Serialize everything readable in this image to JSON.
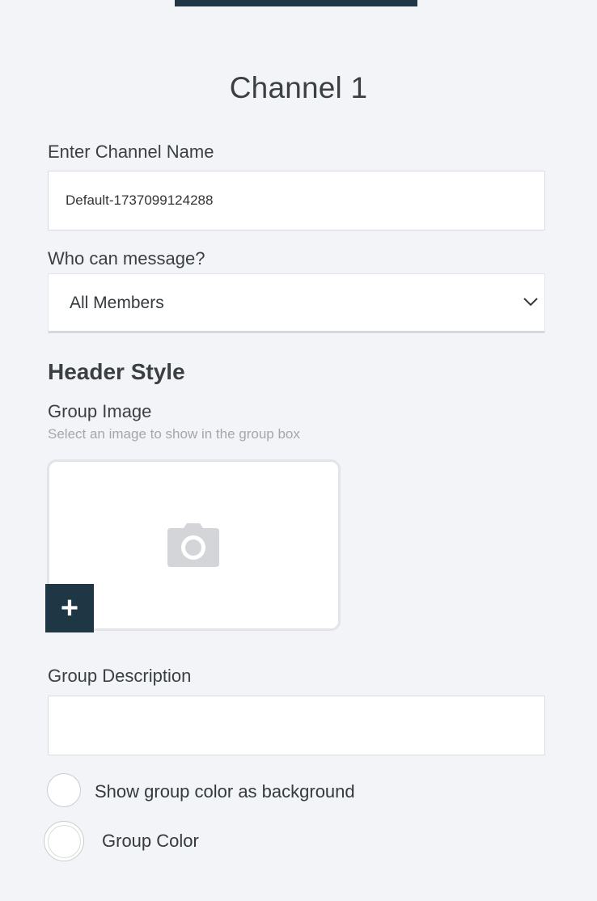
{
  "header": {
    "title": "Channel 1"
  },
  "channel_name": {
    "label": "Enter Channel Name",
    "value": "Default-1737099124288"
  },
  "message_permission": {
    "label": "Who can message?",
    "selected": "All Members"
  },
  "header_style": {
    "heading": "Header Style",
    "group_image": {
      "label": "Group Image",
      "hint": "Select an image to show in the group box",
      "placeholder_icon": "camera-icon",
      "add_icon": "plus-icon",
      "add_symbol": "+"
    },
    "group_description": {
      "label": "Group Description",
      "value": ""
    },
    "show_color_background": {
      "label": "Show group color as background",
      "checked": false
    },
    "group_color": {
      "label": "Group Color",
      "value": "#ffffff"
    }
  },
  "colors": {
    "accent": "#1f3644",
    "background": "#f3f4f8"
  }
}
